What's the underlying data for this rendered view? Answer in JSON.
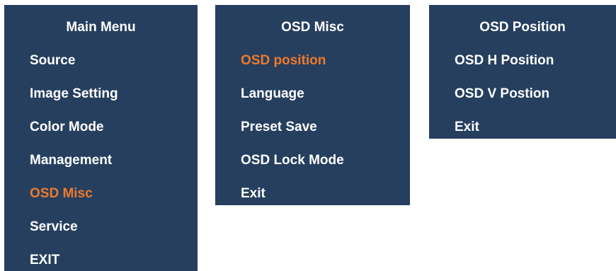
{
  "main_menu": {
    "title": "Main Menu",
    "items": [
      {
        "label": "Source",
        "active": false
      },
      {
        "label": "Image Setting",
        "active": false
      },
      {
        "label": "Color Mode",
        "active": false
      },
      {
        "label": "Management",
        "active": false
      },
      {
        "label": "OSD Misc",
        "active": true
      },
      {
        "label": "Service",
        "active": false
      },
      {
        "label": "EXIT",
        "active": false
      }
    ]
  },
  "osd_misc": {
    "title": "OSD Misc",
    "items": [
      {
        "label": "OSD position",
        "active": true
      },
      {
        "label": "Language",
        "active": false
      },
      {
        "label": "Preset Save",
        "active": false
      },
      {
        "label": "OSD Lock Mode",
        "active": false
      },
      {
        "label": "Exit",
        "active": false
      }
    ]
  },
  "osd_position": {
    "title": "OSD Position",
    "items": [
      {
        "label": "OSD H Position",
        "active": false
      },
      {
        "label": "OSD V Postion",
        "active": false
      },
      {
        "label": "Exit",
        "active": false
      }
    ]
  },
  "colors": {
    "panel_background": "#263f5f",
    "text": "#ffffff",
    "highlight": "#f07a2a"
  }
}
